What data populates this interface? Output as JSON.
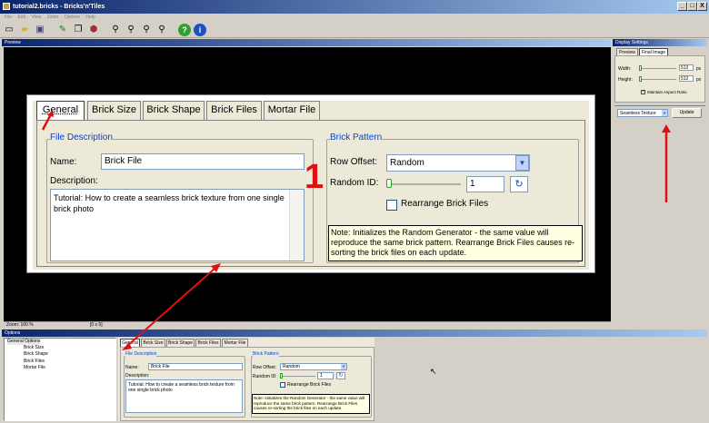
{
  "window": {
    "title": "tutorial2.bricks - Bricks'n'Tiles",
    "buttons": [
      "_",
      "□",
      "X"
    ]
  },
  "menu": [
    "File",
    "Edit",
    "View",
    "Zoom",
    "Options",
    "Help"
  ],
  "toolbar": [
    "new-file-icon",
    "open-folder-icon",
    "save-icon",
    "edit-icon",
    "copy-icon",
    "dice-icon",
    "zoom-icon",
    "zoom-in-icon",
    "zoom-out-icon",
    "zoom-fit-icon",
    "help-icon",
    "info-icon"
  ],
  "preview": {
    "title": "Preview",
    "zoom": "Zoom: 100 %",
    "coords": "[0 x 0]"
  },
  "display_settings": {
    "title": "Display Settings",
    "tabs": [
      "Preview",
      "Final Image"
    ],
    "width_label": "Width:",
    "width": "512",
    "height_label": "Height:",
    "height": "512",
    "unit": "px",
    "aspect": "Maintain Aspect Ratio",
    "mode": "Seamless Texture",
    "update": "Update"
  },
  "options": {
    "title": "Options",
    "tree": [
      "General Options",
      "Brick Size",
      "Brick Shape",
      "Brick Files",
      "Mortar File"
    ]
  },
  "form": {
    "tabs": [
      "General",
      "Brick Size",
      "Brick Shape",
      "Brick Files",
      "Mortar File"
    ],
    "file_description": "File Description",
    "name_label": "Name:",
    "name_value": "Brick File",
    "description_label": "Description:",
    "description_value": "Tutorial: How to create a seamless brick texture from one single brick photo",
    "brick_pattern": "Brick Pattern",
    "row_offset_label": "Row Offset:",
    "row_offset_value": "Random",
    "random_id_label": "Random ID:",
    "random_id_value": "1",
    "rearrange": "Rearrange Brick Files",
    "note": "Note: Initializes the Random Generator - the same value will reproduce the same brick pattern. Rearrange Brick Files causes re-sorting the brick files on each update."
  },
  "annotation": "1",
  "colors": {
    "accent_red": "#e01010",
    "title_blue": "#0a246a",
    "group_label_blue": "#0046d5"
  }
}
